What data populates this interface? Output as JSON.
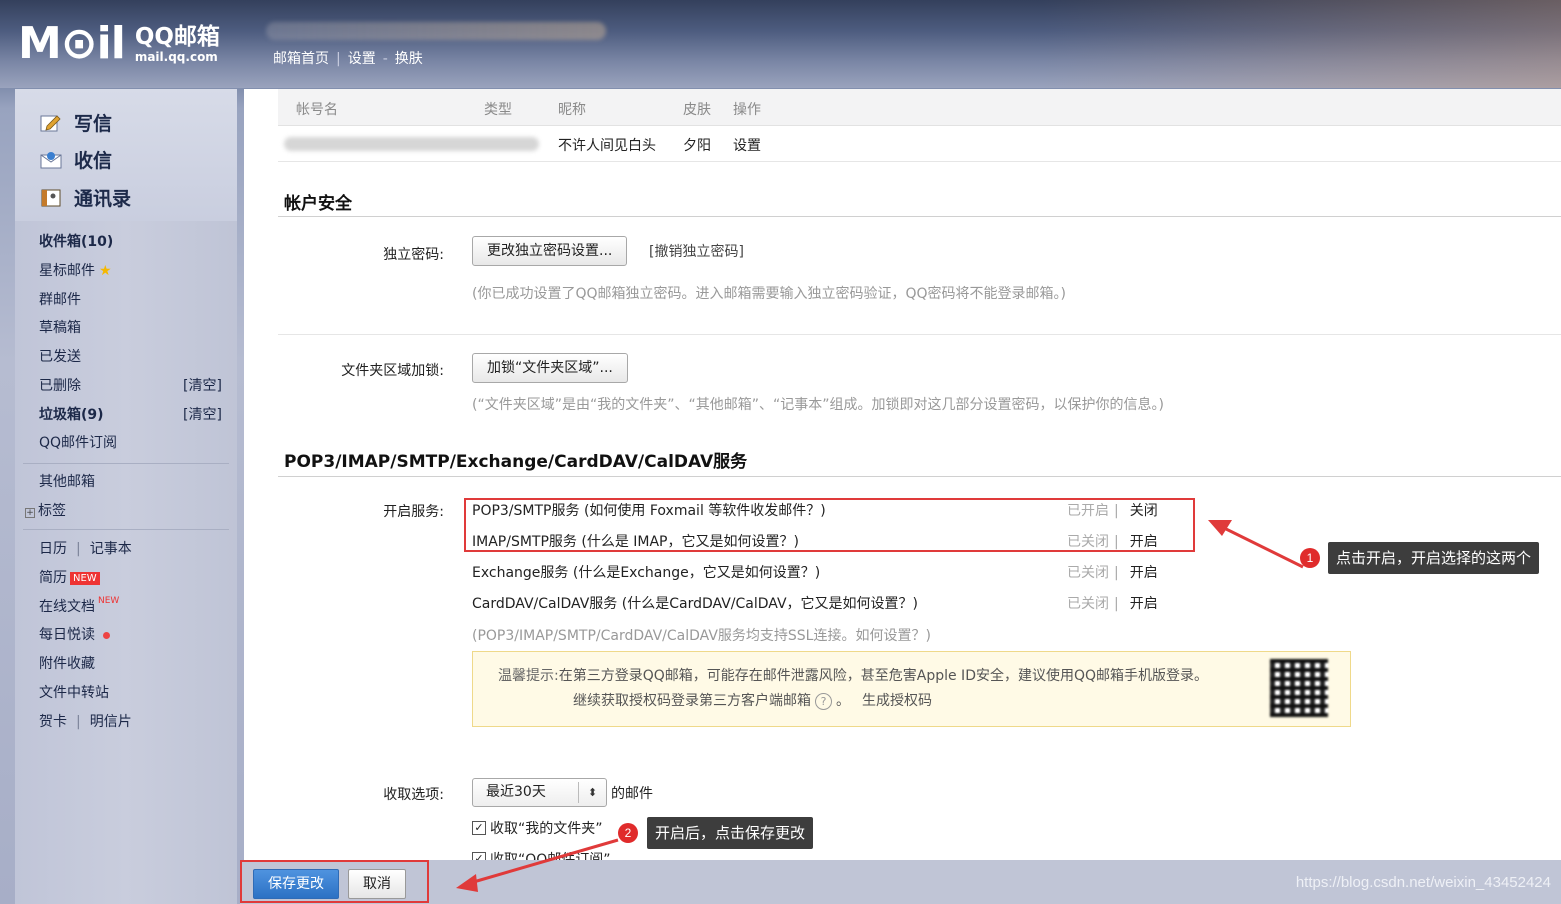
{
  "header": {
    "logo_text": "M⊙il",
    "logo_cn": "QQ邮箱",
    "logo_domain": "mail.qq.com",
    "nav": [
      "邮箱首页",
      "设置",
      "换肤"
    ]
  },
  "sidebar": {
    "compose": "写信",
    "inbox_main": "收信",
    "contacts": "通讯录",
    "folders": [
      {
        "label": "收件箱(10)"
      },
      {
        "label": "星标邮件"
      },
      {
        "label": "群邮件"
      },
      {
        "label": "草稿箱"
      },
      {
        "label": "已发送"
      },
      {
        "label": "已删除",
        "action": "[清空]"
      },
      {
        "label": "垃圾箱(9)",
        "action": "[清空]"
      },
      {
        "label": "QQ邮件订阅"
      }
    ],
    "other_mail": "其他邮箱",
    "tags": "标签",
    "calendar": "日历",
    "notebook": "记事本",
    "resume": "简历",
    "resume_badge": "NEW",
    "docs": "在线文档",
    "docs_badge": "NEW",
    "daily_read": "每日悦读",
    "attachments": "附件收藏",
    "transfer": "文件中转站",
    "card": "贺卡",
    "postcard": "明信片"
  },
  "accounts": {
    "headers": [
      "帐号名",
      "类型",
      "昵称",
      "皮肤",
      "操作"
    ],
    "row": {
      "nickname": "不许人间见白头",
      "skin": "夕阳",
      "action": "设置"
    }
  },
  "security": {
    "title": "帐户安全",
    "pwd_label": "独立密码:",
    "pwd_button": "更改独立密码设置...",
    "pwd_revoke": "[撤销独立密码]",
    "pwd_hint": "(你已成功设置了QQ邮箱独立密码。进入邮箱需要输入独立密码验证，QQ密码将不能登录邮箱。)",
    "lock_label": "文件夹区域加锁:",
    "lock_button": "加锁“文件夹区域”...",
    "lock_hint": "(“文件夹区域”是由“我的文件夹”、“其他邮箱”、“记事本”组成。加锁即对这几部分设置密码，以保护你的信息。)"
  },
  "services": {
    "title": "POP3/IMAP/SMTP/Exchange/CardDAV/CalDAV服务",
    "label": "开启服务:",
    "items": [
      {
        "name": "POP3/SMTP服务",
        "help": "(如何使用 Foxmail 等软件收发邮件？)",
        "status": "已开启",
        "action": "关闭"
      },
      {
        "name": "IMAP/SMTP服务",
        "help": "(什么是 IMAP，它又是如何设置？)",
        "status": "已关闭",
        "action": "开启"
      },
      {
        "name": "Exchange服务",
        "help": "(什么是Exchange，它又是如何设置？)",
        "status": "已关闭",
        "action": "开启"
      },
      {
        "name": "CardDAV/CalDAV服务",
        "help": "(什么是CardDAV/CalDAV，它又是如何设置？)",
        "status": "已关闭",
        "action": "开启"
      }
    ],
    "ssl_hint": "(POP3/IMAP/SMTP/CardDAV/CalDAV服务均支持SSL连接。如何设置？)",
    "tip_prefix": "温馨提示:",
    "tip_line1": "在第三方登录QQ邮箱，可能存在邮件泄露风险，甚至危害Apple ID安全，建议使用QQ邮箱手机版登录。",
    "tip_line2": "继续获取授权码登录第三方客户端邮箱",
    "tip_help": "?",
    "tip_end": "。",
    "gen_code": "生成授权码"
  },
  "fetch": {
    "label": "收取选项:",
    "select_value": "最近30天",
    "suffix": "的邮件",
    "opt1": "收取“我的文件夹”",
    "opt2": "收取“QQ邮件订阅”"
  },
  "footer": {
    "save": "保存更改",
    "cancel": "取消",
    "watermark": "https://blog.csdn.net/weixin_43452424"
  },
  "annotations": {
    "n1": "1",
    "note1": "点击开启，开启选择的这两个",
    "n2": "2",
    "note2": "开启后，点击保存更改"
  },
  "colors": {
    "annotation_red": "#e03a3a",
    "primary_blue": "#2c71c4"
  }
}
